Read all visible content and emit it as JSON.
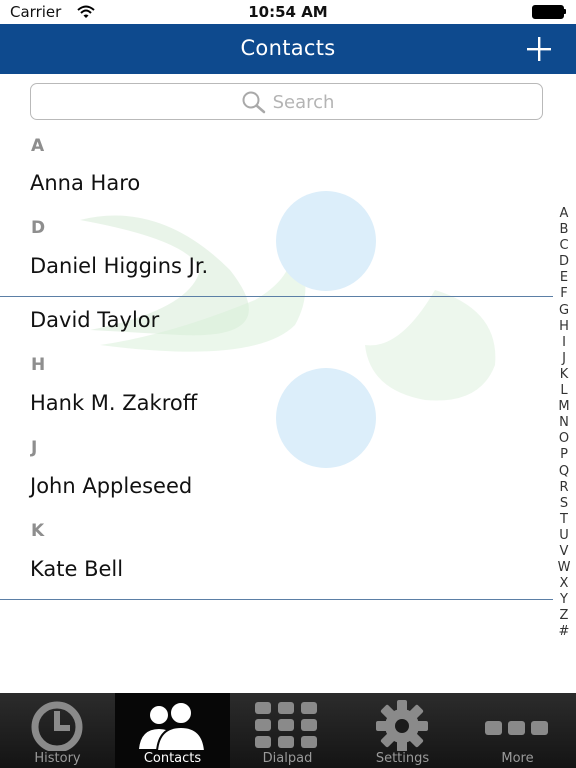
{
  "status_bar": {
    "carrier": "Carrier",
    "time": "10:54 AM"
  },
  "nav": {
    "title": "Contacts",
    "add_icon": "plus-icon"
  },
  "search": {
    "placeholder": "Search",
    "icon": "search-icon"
  },
  "sections": [
    {
      "letter": "A",
      "contacts": [
        "Anna Haro"
      ]
    },
    {
      "letter": "D",
      "contacts": [
        "Daniel Higgins Jr.",
        "David Taylor"
      ]
    },
    {
      "letter": "H",
      "contacts": [
        "Hank M. Zakroff"
      ]
    },
    {
      "letter": "J",
      "contacts": [
        "John Appleseed"
      ]
    },
    {
      "letter": "K",
      "contacts": [
        "Kate Bell"
      ]
    }
  ],
  "index_letters": [
    "A",
    "B",
    "C",
    "D",
    "E",
    "F",
    "G",
    "H",
    "I",
    "J",
    "K",
    "L",
    "M",
    "N",
    "O",
    "P",
    "Q",
    "R",
    "S",
    "T",
    "U",
    "V",
    "W",
    "X",
    "Y",
    "Z",
    "#"
  ],
  "tabs": [
    {
      "label": "History",
      "icon": "clock-icon",
      "active": false
    },
    {
      "label": "Contacts",
      "icon": "people-icon",
      "active": true
    },
    {
      "label": "Dialpad",
      "icon": "dialpad-icon",
      "active": false
    },
    {
      "label": "Settings",
      "icon": "gear-icon",
      "active": false
    },
    {
      "label": "More",
      "icon": "more-icon",
      "active": false
    }
  ],
  "colors": {
    "nav_bar": "#0e4a8e",
    "tab_bar": "#1f1f1f",
    "section_header": "#8e8e8e",
    "divider": "#5b7fa6"
  }
}
